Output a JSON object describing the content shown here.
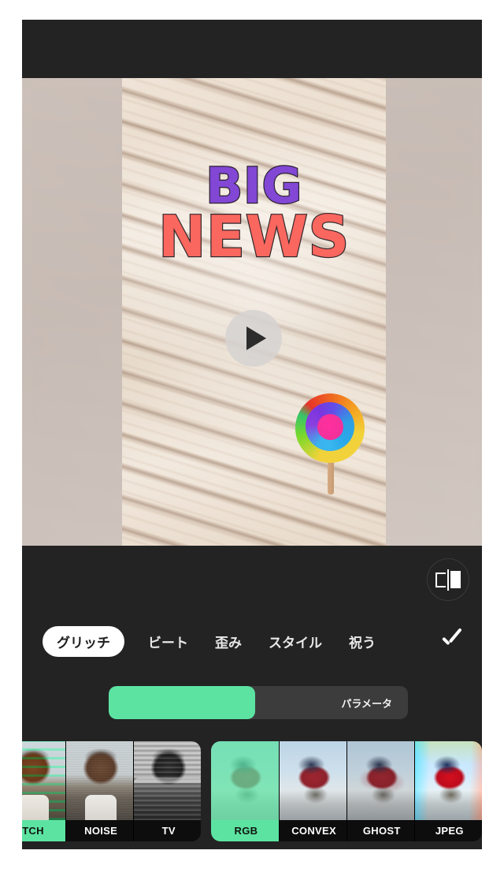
{
  "app": {
    "accent_color": "#5ce3a2",
    "background_color": "#232323"
  },
  "preview": {
    "headline_line1": "BIG",
    "headline_line2": "NEWS",
    "headline_line1_color": "#8247d4",
    "headline_line2_color": "#f9675f",
    "play_icon": "play-icon",
    "sticker_icon": "lollipop-sticker"
  },
  "toolbar": {
    "compare_icon": "compare-before-after-icon"
  },
  "tabs": {
    "items": [
      {
        "label": "グリッチ",
        "active": true
      },
      {
        "label": "ビート",
        "active": false
      },
      {
        "label": "歪み",
        "active": false
      },
      {
        "label": "スタイル",
        "active": false
      },
      {
        "label": "祝う",
        "active": false
      }
    ],
    "confirm_icon": "checkmark-icon"
  },
  "slider": {
    "label": "パラメータ",
    "fill_percent": 49,
    "fill_color": "#5ce3a2",
    "track_color": "#3c3c3c"
  },
  "filmstrip": {
    "group1": [
      {
        "label": "TCH",
        "selected": true,
        "style": "img-glitch"
      },
      {
        "label": "NOISE",
        "selected": false,
        "style": "img-noise"
      },
      {
        "label": "TV",
        "selected": false,
        "style": "img-tv"
      }
    ],
    "group2": [
      {
        "label": "RGB",
        "selected": true,
        "style": "img-rgbsel"
      },
      {
        "label": "CONVEX",
        "selected": false,
        "style": "img-convex"
      },
      {
        "label": "GHOST",
        "selected": false,
        "style": "img-ghost"
      },
      {
        "label": "JPEG",
        "selected": false,
        "style": "img-jpeg"
      }
    ]
  }
}
